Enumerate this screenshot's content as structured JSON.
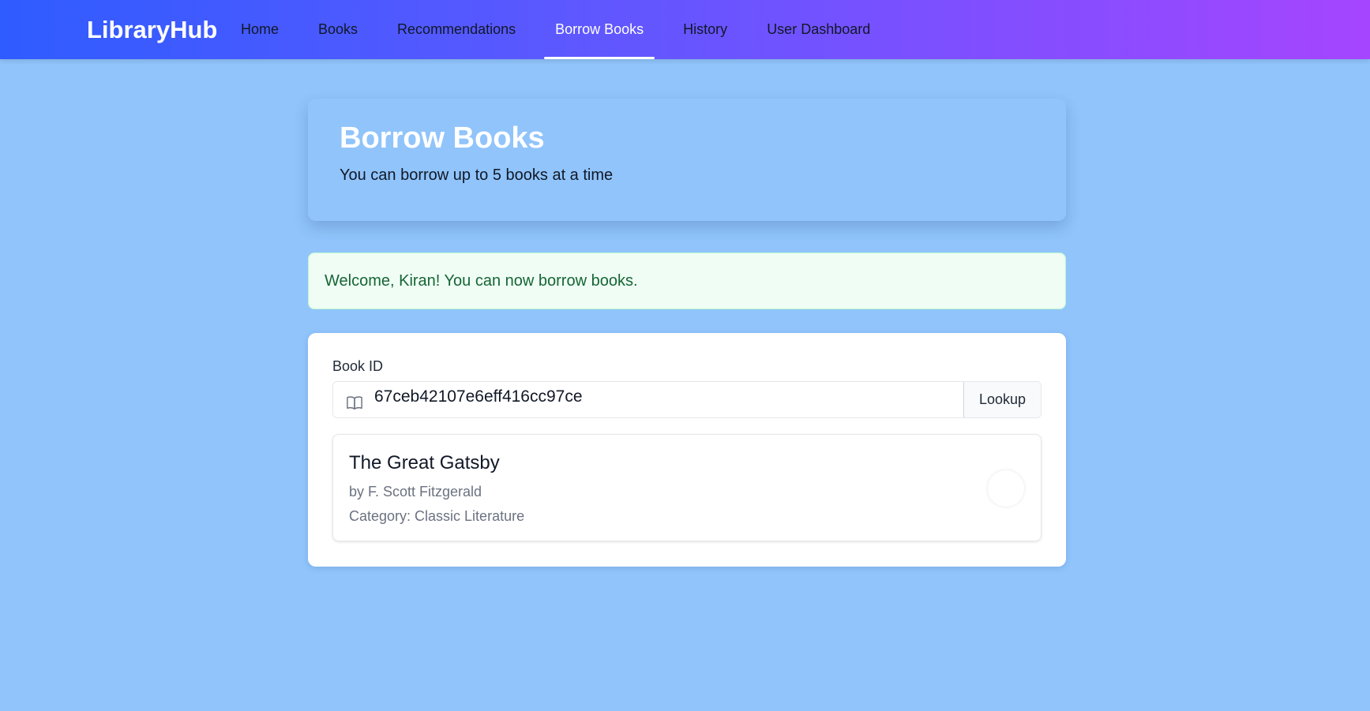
{
  "nav": {
    "brand": "LibraryHub",
    "links": [
      {
        "label": "Home"
      },
      {
        "label": "Books"
      },
      {
        "label": "Recommendations"
      },
      {
        "label": "Borrow Books",
        "active": true
      },
      {
        "label": "History"
      },
      {
        "label": "User Dashboard"
      }
    ]
  },
  "header": {
    "title": "Borrow Books",
    "subtitle": "You can borrow up to 5 books at a time"
  },
  "alert": {
    "message": "Welcome, Kiran! You can now borrow books."
  },
  "form": {
    "label": "Book ID",
    "book_id_value": "67ceb42107e6eff416cc97ce",
    "lookup_label": "Lookup",
    "icon": "book-open-icon"
  },
  "book": {
    "title": "The Great Gatsby",
    "author": "by F. Scott Fitzgerald",
    "category": "Category: Classic Literature"
  },
  "colors": {
    "nav_gradient_start": "#2f5cff",
    "nav_gradient_end": "#a645ff",
    "page_background": "#90c4fb",
    "alert_background": "#effdf4",
    "alert_text": "#166534"
  }
}
